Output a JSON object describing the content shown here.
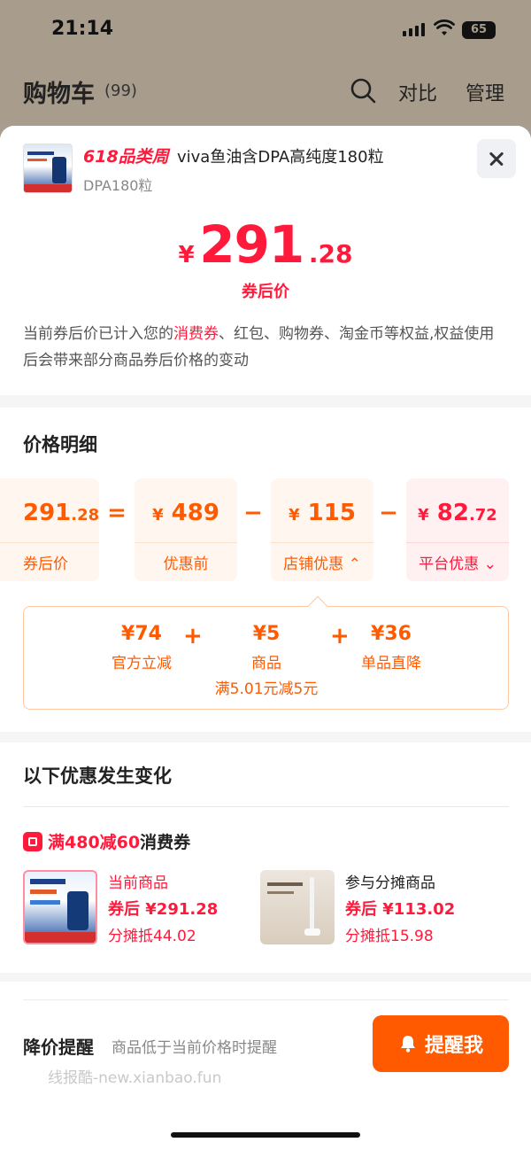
{
  "status_bar": {
    "time": "21:14",
    "battery": "65"
  },
  "header": {
    "title": "购物车",
    "count": "(99)",
    "compare": "对比",
    "manage": "管理"
  },
  "product": {
    "promo_tag": "618品类周",
    "title": "viva鱼油含DPA高纯度180粒",
    "sku": "DPA180粒"
  },
  "price": {
    "currency": "¥",
    "integer": "291",
    "decimal": ".28",
    "label": "券后价",
    "notice_before": "当前券后价已计入您的",
    "notice_highlight": "消费券",
    "notice_after": "、红包、购物券、淘金币等权益,权益使用后会带来部分商品券后价格的变动"
  },
  "price_detail": {
    "title": "价格明细",
    "boxes": [
      {
        "value": "291",
        "decimal": ".28",
        "currency": "",
        "label": "券后价"
      },
      {
        "value": "489",
        "decimal": "",
        "currency": "¥",
        "label": "优惠前"
      },
      {
        "value": "115",
        "decimal": "",
        "currency": "¥",
        "label": "店铺优惠",
        "arrow": "⌃"
      },
      {
        "value": "82",
        "decimal": ".72",
        "currency": "¥",
        "label": "平台优惠",
        "arrow": "⌄"
      }
    ],
    "operators": [
      "=",
      "−",
      "−"
    ],
    "breakdown": [
      {
        "value": "¥74",
        "name": "官方立减",
        "note": ""
      },
      {
        "value": "¥5",
        "name": "商品",
        "note": "满5.01元减5元"
      },
      {
        "value": "¥36",
        "name": "单品直降",
        "note": ""
      }
    ],
    "plus": "+"
  },
  "changes": {
    "title": "以下优惠发生变化",
    "coupon_red": "满480减60",
    "coupon_suffix": "消费券",
    "items": [
      {
        "label": "当前商品",
        "price": "券后 ¥291.28",
        "share": "分摊抵44.02"
      },
      {
        "label": "参与分摊商品",
        "price": "券后 ¥113.02",
        "share": "分摊抵15.98"
      }
    ]
  },
  "reminder": {
    "title": "降价提醒",
    "desc": "商品低于当前价格时提醒",
    "button": "提醒我",
    "watermark": "线报酷-new.xianbao.fun"
  },
  "colors": {
    "red": "#ff1a3c",
    "orange": "#ff5a00"
  },
  "icons": [
    "search-icon",
    "close-icon",
    "bell-icon",
    "coupon-icon",
    "wifi-icon",
    "signal-icon",
    "battery-icon"
  ]
}
